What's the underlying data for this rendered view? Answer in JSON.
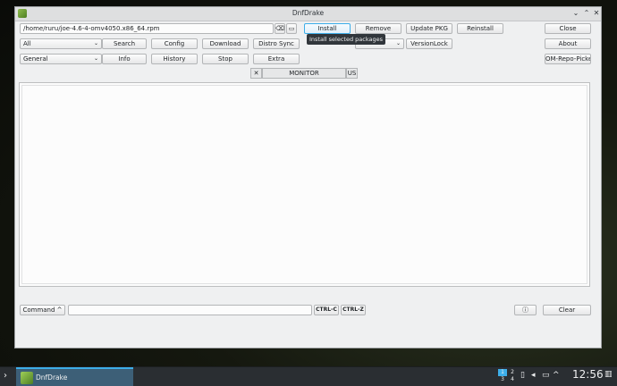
{
  "window": {
    "title": "DnfDrake",
    "controls": [
      "⌄",
      "⌃",
      "✕"
    ]
  },
  "path_field": {
    "value": "/home/ruru/joe-4.6-4-omv4050.x86_64.rpm"
  },
  "icons": {
    "clear": "clear-icon",
    "folder": "folder-icon"
  },
  "toolbar": {
    "install": "Install",
    "remove": "Remove",
    "update_pkg": "Update PKG",
    "reinstall": "Reinstall",
    "close": "Close",
    "search": "Search",
    "config": "Config",
    "download": "Download",
    "distro_sync": "Distro Sync",
    "versionlock": "VersionLock",
    "about": "About",
    "info": "Info",
    "history": "History",
    "stop": "Stop",
    "extra": "Extra",
    "om_repo_picker": "OM-Repo-Picker"
  },
  "combos": {
    "filter": "All",
    "group": "General"
  },
  "tooltip": "Install selected packages",
  "monitor": {
    "pin": "✕",
    "label": "MONITOR",
    "lang": "US"
  },
  "bottom": {
    "command": "Command ^",
    "command_value": "",
    "ctrl_c": "CTRL-C",
    "ctrl_z": "CTRL-Z",
    "info_icon": "ⓘ",
    "clear": "Clear"
  },
  "taskbar": {
    "task_label": "DnfDrake",
    "pager": [
      "1",
      "2",
      "3",
      "4"
    ],
    "clock": "12:56"
  }
}
